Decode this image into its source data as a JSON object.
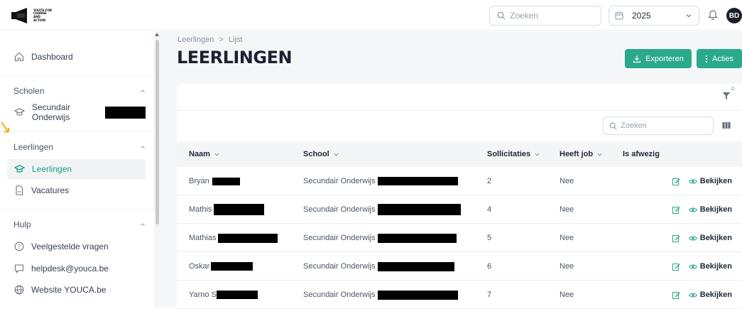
{
  "header": {
    "logo_text": "YOUTH FOR CHANGE AND ACTION",
    "search_placeholder": "Zoeken",
    "year": "2025",
    "avatar_initials": "BD"
  },
  "sidebar": {
    "dashboard": "Dashboard",
    "section_schools": "Scholen",
    "school_item": "Secundair Onderwijs",
    "section_students": "Leerlingen",
    "students_item": "Leerlingen",
    "vacancies_item": "Vacatures",
    "section_help": "Hulp",
    "faq": "Veelgestelde vragen",
    "helpdesk": "helpdesk@youca.be",
    "website": "Website YOUCA.be"
  },
  "main": {
    "breadcrumb": [
      "Leerlingen",
      "Lijst"
    ],
    "title": "LEERLINGEN",
    "export_label": "Exporteren",
    "actions_label": "Acties",
    "filter_count": "0",
    "search_placeholder": "Zoeken",
    "columns": [
      "Naam",
      "School",
      "Sollicitaties",
      "Heeft job",
      "Is afwezig"
    ],
    "view_label": "Bekijken",
    "rows": [
      {
        "name": "Bryan",
        "school": "Secundair Onderwijs",
        "applications": "2",
        "has_job": "Nee"
      },
      {
        "name": "Mathis",
        "school": "Secundair Onderwijs",
        "applications": "4",
        "has_job": "Nee"
      },
      {
        "name": "Mathias",
        "school": "Secundair Onderwijs",
        "applications": "5",
        "has_job": "Nee"
      },
      {
        "name": "Oskar",
        "school": "Secundair Onderwijs",
        "applications": "6",
        "has_job": "Nee"
      },
      {
        "name": "Yarno S",
        "school": "Secundair Onderwijs",
        "applications": "7",
        "has_job": "Nee"
      }
    ]
  },
  "colors": {
    "accent": "#2aa98c",
    "active_text": "#1a9e86",
    "redaction": "#000000"
  }
}
